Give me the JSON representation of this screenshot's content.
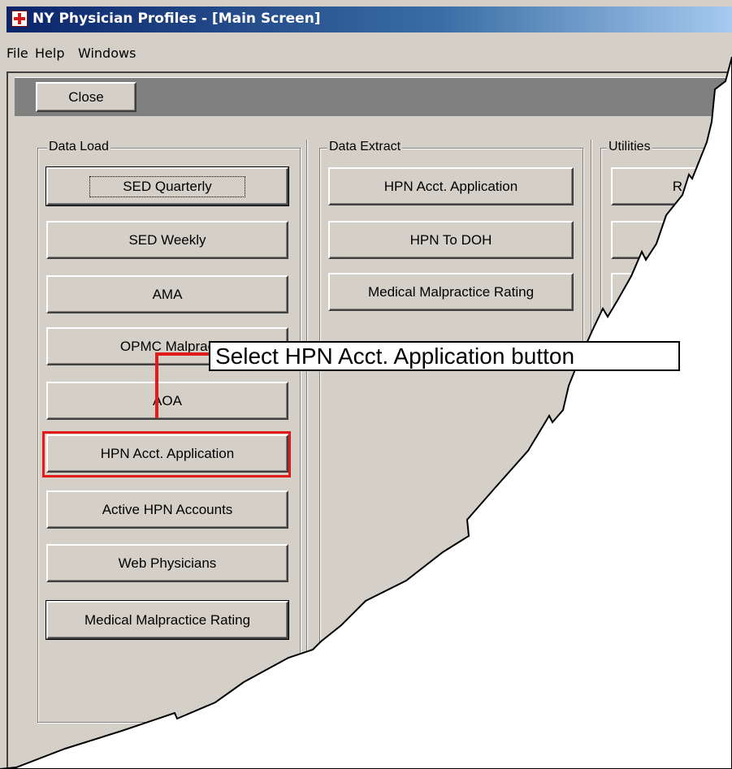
{
  "window": {
    "title": "NY Physician Profiles - [Main Screen]"
  },
  "menu": {
    "file": "File",
    "help": "Help",
    "windows": "Windows"
  },
  "toolbar": {
    "close_label": "Close"
  },
  "groups": {
    "data_load": {
      "label": "Data Load",
      "buttons": {
        "sed_quarterly": "SED Quarterly",
        "sed_weekly": "SED Weekly",
        "ama": "AMA",
        "opmc": "OPMC Malprac",
        "aoa": "AOA",
        "hpn_acct": "HPN Acct. Application",
        "active_hpn": "Active HPN Accounts",
        "web_physicians": "Web Physicians",
        "med_malpractice": "Medical Malpractice Rating"
      }
    },
    "data_extract": {
      "label": "Data Extract",
      "buttons": {
        "hpn_acct": "HPN Acct. Application",
        "hpn_to_doh": "HPN To DOH",
        "med_malpractice": "Medical Malpractice Rating"
      }
    },
    "utilities": {
      "label": "Utilities",
      "button_partial": "R"
    }
  },
  "annotation": {
    "text": "Select HPN Acct. Application button",
    "highlight_color": "#e21a1a"
  }
}
